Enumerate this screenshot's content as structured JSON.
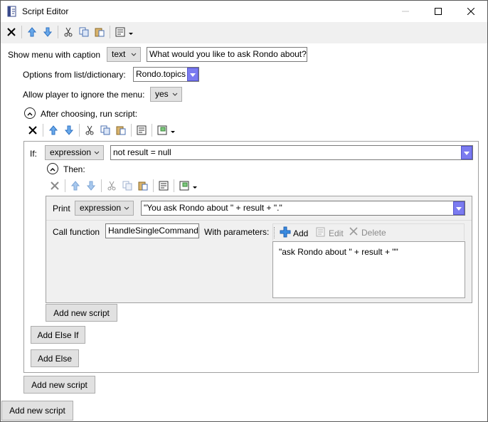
{
  "window": {
    "title": "Script Editor",
    "min_icon": "minimize-icon",
    "max_icon": "maximize-icon",
    "close_icon": "close-icon"
  },
  "menu": {
    "caption_label": "Show menu with caption",
    "caption_type": "text",
    "caption_value": "What would you like to ask Rondo about?",
    "options_label": "Options from list/dictionary:",
    "options_value": "Rondo.topics",
    "ignore_label": "Allow player to ignore the menu:",
    "ignore_value": "yes",
    "after_label": "After choosing, run script:"
  },
  "if_block": {
    "if_label": "If:",
    "if_type": "expression",
    "if_value": "not result = null",
    "then_label": "Then:"
  },
  "print_block": {
    "print_label": "Print",
    "print_type": "expression",
    "print_value": "\"You ask Rondo about \" + result + \".\""
  },
  "call_block": {
    "call_label": "Call function",
    "function_name": "HandleSingleCommand",
    "params_label": "With parameters:",
    "add_label": "Add",
    "edit_label": "Edit",
    "delete_label": "Delete",
    "param_value": "\"ask Rondo about \" + result + \"\""
  },
  "buttons": {
    "add_new_script_inner": "Add new script",
    "add_else_if": "Add Else If",
    "add_else": "Add Else",
    "add_new_script_mid": "Add new script",
    "add_new_script_outer": "Add new script"
  },
  "colors": {
    "dropdown_accent": "#7b7bf0",
    "arrow_blue": "#4a90e2",
    "add_plus": "#2e7fd6"
  }
}
